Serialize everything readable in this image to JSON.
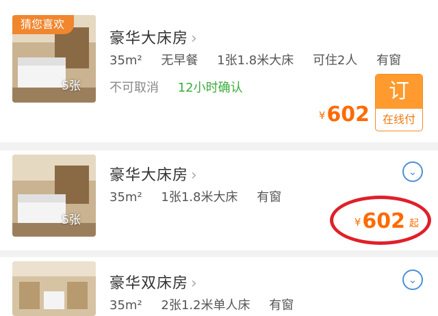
{
  "colors": {
    "accent": "#ff6a00",
    "tag": "#f0862e",
    "confirm": "#3cab3c",
    "link": "#4a8fd6",
    "highlight": "#e0202a"
  },
  "rooms": [
    {
      "tag": "猜您喜欢",
      "title": "豪华大床房",
      "photo_count": "5张",
      "specs": [
        "35m²",
        "无早餐",
        "1张1.8米大床",
        "可住2人",
        "有窗"
      ],
      "policy": "不可取消",
      "confirm": "12小时确认",
      "currency": "¥",
      "price": "602",
      "book_label": "订",
      "pay_label": "在线付"
    },
    {
      "title": "豪华大床房",
      "photo_count": "5张",
      "specs": [
        "35m²",
        "1张1.8米大床",
        "有窗"
      ],
      "currency": "¥",
      "price": "602",
      "price_suffix": "起",
      "expand_icon": "chevron-down-circle-icon"
    },
    {
      "title": "豪华双床房",
      "specs": [
        "35m²",
        "2张1.2米单人床",
        "有窗"
      ],
      "expand_icon": "chevron-down-circle-icon"
    }
  ]
}
